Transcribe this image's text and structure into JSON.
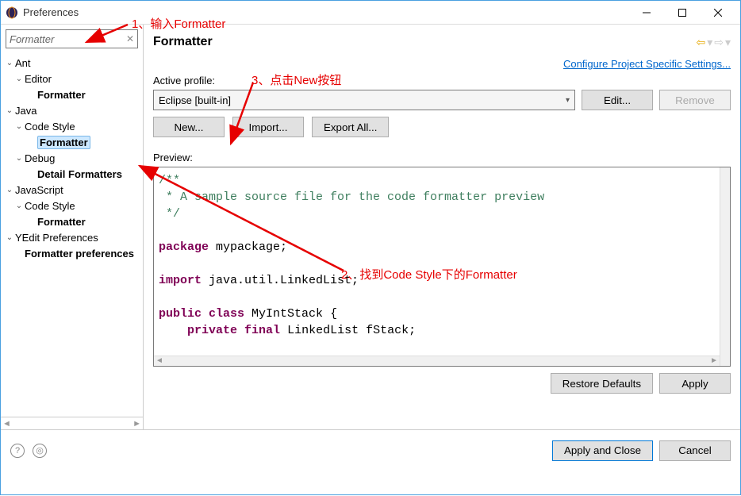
{
  "window": {
    "title": "Preferences"
  },
  "sidebar": {
    "filter_value": "Formatter",
    "items": [
      {
        "label": "Ant",
        "level": 1,
        "exp": "v"
      },
      {
        "label": "Editor",
        "level": 2,
        "exp": "v"
      },
      {
        "label": "Formatter",
        "level": 3,
        "bold": true
      },
      {
        "label": "Java",
        "level": 1,
        "exp": "v"
      },
      {
        "label": "Code Style",
        "level": 2,
        "exp": "v"
      },
      {
        "label": "Formatter",
        "level": 3,
        "bold": true,
        "selected": true
      },
      {
        "label": "Debug",
        "level": 2,
        "exp": "v"
      },
      {
        "label": "Detail Formatters",
        "level": 3,
        "bold": true
      },
      {
        "label": "JavaScript",
        "level": 1,
        "exp": "v"
      },
      {
        "label": "Code Style",
        "level": 2,
        "exp": "v"
      },
      {
        "label": "Formatter",
        "level": 3,
        "bold": true
      },
      {
        "label": "YEdit Preferences",
        "level": 1,
        "exp": "v"
      },
      {
        "label": "Formatter preferences",
        "level": 2,
        "bold": true
      }
    ]
  },
  "content": {
    "heading": "Formatter",
    "config_link": "Configure Project Specific Settings...",
    "active_profile_label": "Active profile:",
    "active_profile_value": "Eclipse [built-in]",
    "edit_btn": "Edit...",
    "remove_btn": "Remove",
    "new_btn": "New...",
    "import_btn": "Import...",
    "export_btn": "Export All...",
    "preview_label": "Preview:",
    "restore_btn": "Restore Defaults",
    "apply_btn": "Apply"
  },
  "code": {
    "line1": "/**",
    "line2_a": " * A sample source file for the code formatter preview",
    "line3": " */",
    "line5_kw": "package",
    "line5_rest": " mypackage;",
    "line7_kw": "import",
    "line7_rest": " java.util.LinkedList;",
    "line9_kw1": "public",
    "line9_kw2": "class",
    "line9_rest": " MyIntStack {",
    "line10_kw1": "private",
    "line10_kw2": "final",
    "line10_rest": " LinkedList fStack;"
  },
  "footer": {
    "apply_close": "Apply and Close",
    "cancel": "Cancel"
  },
  "annotations": {
    "a1": "1、输入Formatter",
    "a2": "2、找到Code Style下的Formatter",
    "a3": "3、点击New按钮"
  }
}
